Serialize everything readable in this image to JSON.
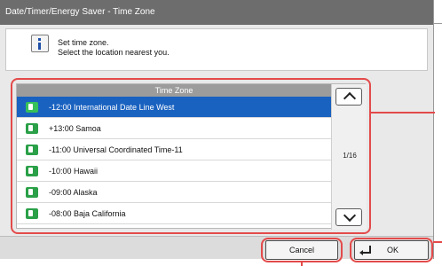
{
  "window": {
    "title": "Date/Timer/Energy Saver - Time Zone"
  },
  "message": {
    "icon": "info-icon",
    "line1": "Set time zone.",
    "line2": "Select the location nearest you."
  },
  "timezone_list": {
    "header": "Time Zone",
    "items": [
      {
        "label": "-12:00 International Date Line West",
        "selected": true
      },
      {
        "label": "+13:00 Samoa",
        "selected": false
      },
      {
        "label": "-11:00 Universal Coordinated Time-11",
        "selected": false
      },
      {
        "label": "-10:00 Hawaii",
        "selected": false
      },
      {
        "label": "-09:00 Alaska",
        "selected": false
      },
      {
        "label": "-08:00 Baja California",
        "selected": false
      }
    ],
    "page_indicator": "1/16",
    "item_icon": "globe-flag-icon",
    "scroll_up_icon": "chevron-up-icon",
    "scroll_down_icon": "chevron-down-icon"
  },
  "buttons": {
    "cancel_label": "Cancel",
    "ok_label": "OK",
    "ok_icon": "enter-icon"
  },
  "colors": {
    "highlight": "#e34a4a",
    "selected_row": "#1a62c0",
    "titlebar": "#6d6d6d"
  }
}
